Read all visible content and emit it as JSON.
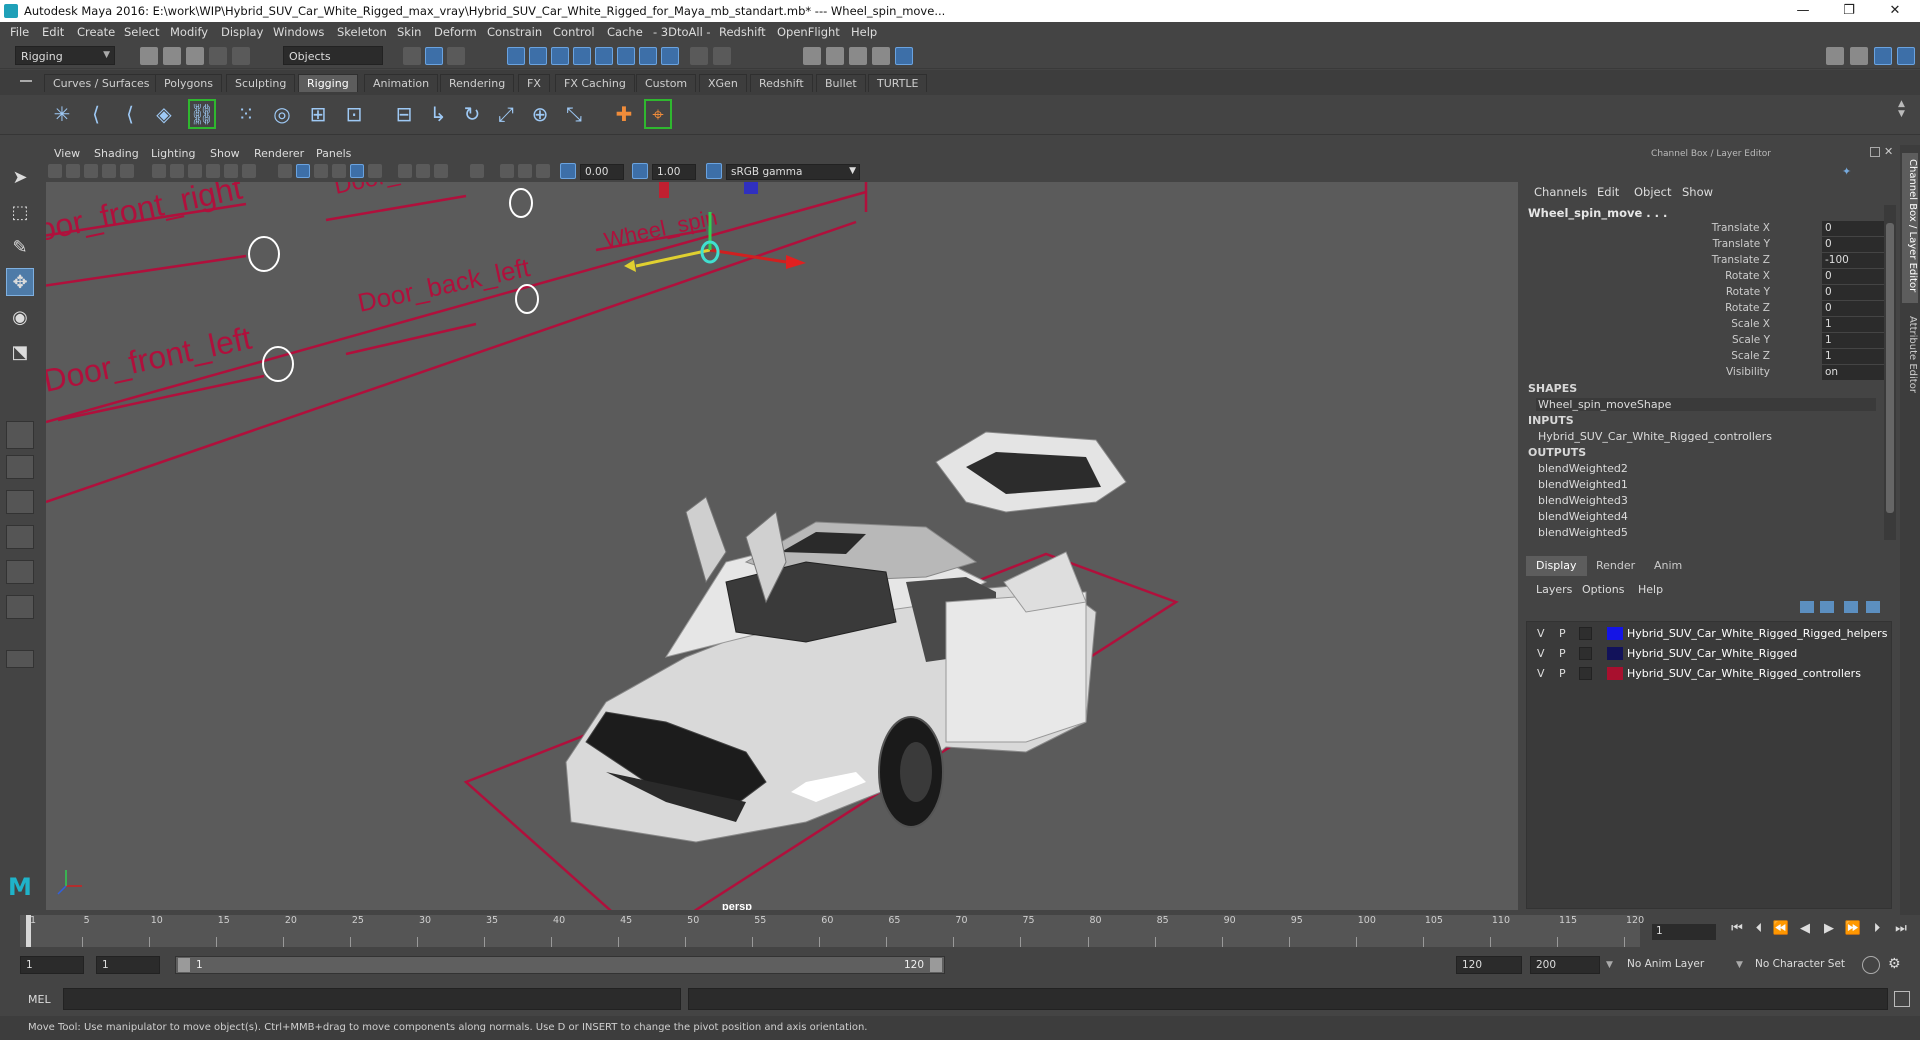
{
  "window": {
    "title": "Autodesk Maya 2016: E:\\work\\WIP\\Hybrid_SUV_Car_White_Rigged_max_vray\\Hybrid_SUV_Car_White_Rigged_for_Maya_mb_standart.mb* --- Wheel_spin_move...",
    "minimize": "—",
    "maximize": "❐",
    "close": "✕"
  },
  "menubar": [
    "File",
    "Edit",
    "Create",
    "Select",
    "Modify",
    "Display",
    "Windows",
    "Skeleton",
    "Skin",
    "Deform",
    "Constrain",
    "Control",
    "Cache",
    "- 3DtoAll -",
    "Redshift",
    "OpenFlight",
    "Help"
  ],
  "statusline": {
    "mode": "Rigging",
    "selection_mode": "Objects"
  },
  "shelf_tabs": [
    "Curves / Surfaces",
    "Polygons",
    "Sculpting",
    "Rigging",
    "Animation",
    "Rendering",
    "FX",
    "FX Caching",
    "Custom",
    "XGen",
    "Redshift",
    "Bullet",
    "TURTLE"
  ],
  "shelf_active_tab": "Rigging",
  "viewport": {
    "menu": [
      "View",
      "Shading",
      "Lighting",
      "Show",
      "Renderer",
      "Panels"
    ],
    "exposure": "0.00",
    "gamma": "1.00",
    "color_space": "sRGB gamma",
    "camera_label": "persp",
    "scene_labels": [
      "oor_front_right",
      "Door_",
      "Wheel_spin",
      "Door_back_left",
      "Door_front_left"
    ]
  },
  "channel_box": {
    "title": "Channel Box / Layer Editor",
    "menu": [
      "Channels",
      "Edit",
      "Object",
      "Show"
    ],
    "object_name": "Wheel_spin_move . . .",
    "attributes": [
      {
        "label": "Translate X",
        "value": "0"
      },
      {
        "label": "Translate Y",
        "value": "0"
      },
      {
        "label": "Translate Z",
        "value": "-100"
      },
      {
        "label": "Rotate X",
        "value": "0"
      },
      {
        "label": "Rotate Y",
        "value": "0"
      },
      {
        "label": "Rotate Z",
        "value": "0"
      },
      {
        "label": "Scale X",
        "value": "1"
      },
      {
        "label": "Scale Y",
        "value": "1"
      },
      {
        "label": "Scale Z",
        "value": "1"
      },
      {
        "label": "Visibility",
        "value": "on"
      }
    ],
    "shapes_header": "SHAPES",
    "shape": "Wheel_spin_moveShape",
    "inputs_header": "INPUTS",
    "input": "Hybrid_SUV_Car_White_Rigged_controllers",
    "outputs_header": "OUTPUTS",
    "outputs": [
      "blendWeighted2",
      "blendWeighted1",
      "blendWeighted3",
      "blendWeighted4",
      "blendWeighted5"
    ]
  },
  "layer_editor": {
    "tabs": [
      "Display",
      "Render",
      "Anim"
    ],
    "menu": [
      "Layers",
      "Options",
      "Help"
    ],
    "layers": [
      {
        "v": "V",
        "p": "P",
        "color": "#1414e6",
        "name": "Hybrid_SUV_Car_White_Rigged_Rigged_helpers"
      },
      {
        "v": "V",
        "p": "P",
        "color": "#12125a",
        "name": "Hybrid_SUV_Car_White_Rigged"
      },
      {
        "v": "V",
        "p": "P",
        "color": "#a8102e",
        "name": "Hybrid_SUV_Car_White_Rigged_controllers"
      }
    ]
  },
  "side_tabs": [
    "Channel Box / Layer Editor",
    "Attribute Editor"
  ],
  "timeline": {
    "ticks": [
      "1",
      "5",
      "10",
      "15",
      "20",
      "25",
      "30",
      "35",
      "40",
      "45",
      "50",
      "55",
      "60",
      "65",
      "70",
      "75",
      "80",
      "85",
      "90",
      "95",
      "100",
      "105",
      "110",
      "115",
      "120"
    ],
    "current_frame": "1"
  },
  "range": {
    "start": "1",
    "start_inner": "1",
    "slider_start": "1",
    "slider_end": "120",
    "end_inner": "120",
    "end": "200",
    "anim_layer": "No Anim Layer",
    "character_set": "No Character Set"
  },
  "command_line": {
    "label": "MEL"
  },
  "help_line": "Move Tool: Use manipulator to move object(s). Ctrl+MMB+drag to move components along normals. Use D or INSERT to change the pivot position and axis orientation."
}
